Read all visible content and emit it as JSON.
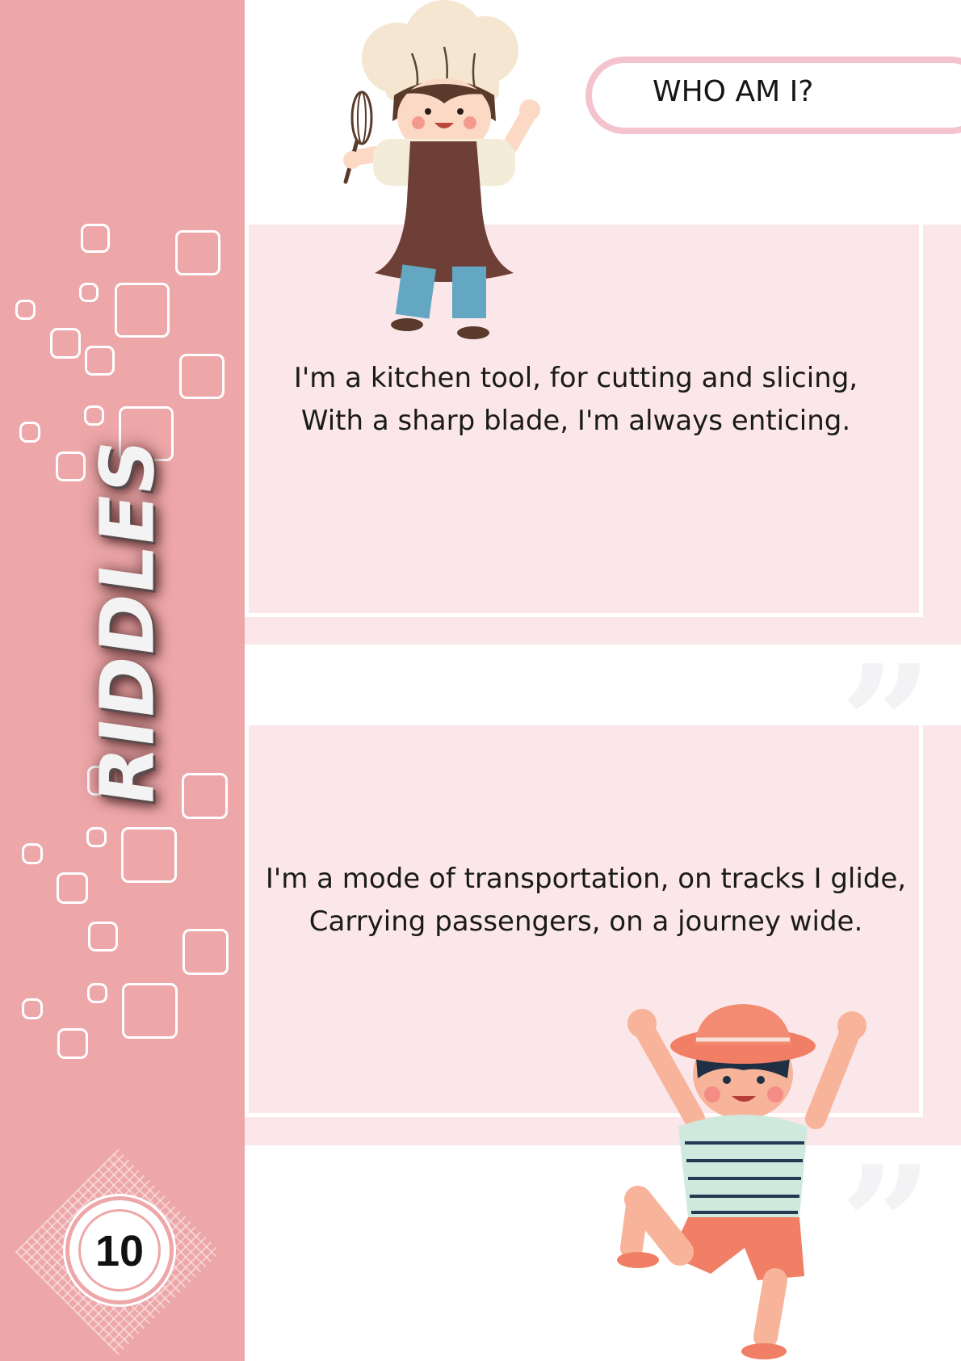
{
  "sidebar": {
    "title": "RIDDLES",
    "page_number": "10"
  },
  "header": {
    "label": "WHO AM I?"
  },
  "riddles": [
    {
      "lines": [
        "I'm a kitchen tool, for cutting and slicing,",
        "With a sharp blade, I'm always enticing."
      ]
    },
    {
      "lines": [
        "I'm a mode of transportation, on tracks I glide,",
        "Carrying passengers, on a journey wide."
      ]
    }
  ],
  "decorations": {
    "top_illustration": "chef-kid-with-whisk",
    "bottom_illustration": "kid-with-bucket-hat-jumping",
    "quote_mark": "”"
  },
  "colors": {
    "sidebar": "#eea7a9",
    "card": "#fbe7e9",
    "pill_border": "#f3c4ce"
  }
}
